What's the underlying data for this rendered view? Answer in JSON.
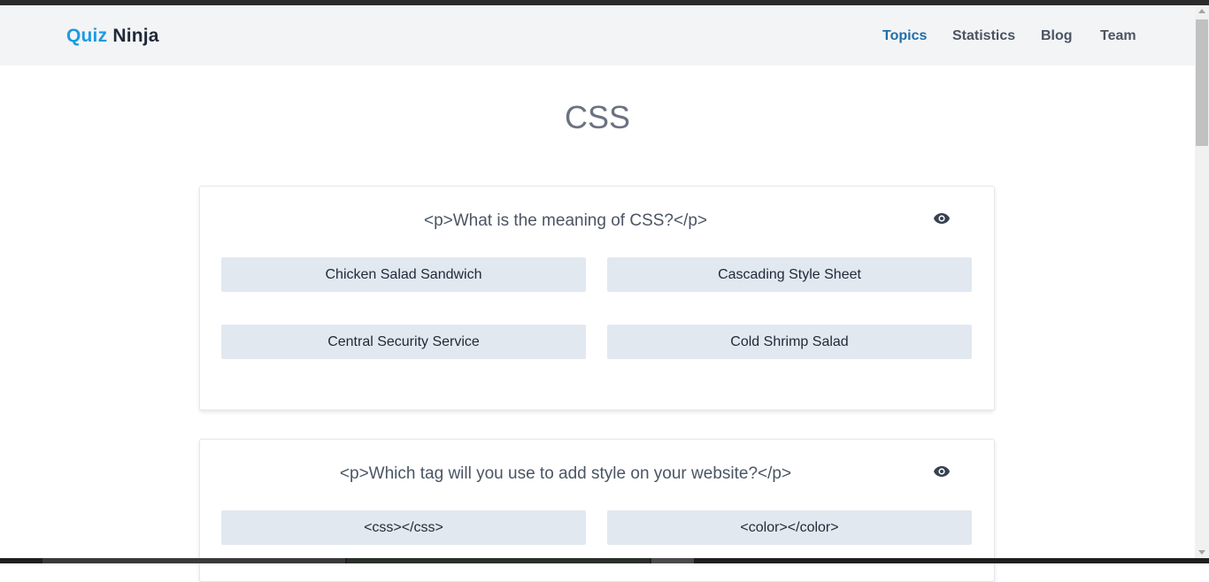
{
  "brand": {
    "part1": "Quiz",
    "part2": "Ninja"
  },
  "nav": {
    "items": [
      {
        "label": "Topics",
        "active": true
      },
      {
        "label": "Statistics",
        "active": false
      },
      {
        "label": "Blog",
        "active": false
      },
      {
        "label": "Team",
        "active": false
      }
    ]
  },
  "page": {
    "title": "CSS"
  },
  "questions": [
    {
      "text": "<p>What is the meaning of CSS?</p>",
      "options": [
        "Chicken Salad Sandwich",
        "Cascading Style Sheet",
        "Central Security Service",
        "Cold Shrimp Salad"
      ]
    },
    {
      "text": "<p>Which tag will you use to add style on your website?</p>",
      "options": [
        "<css></css>",
        "<color></color>"
      ]
    }
  ],
  "colors": {
    "brand_accent": "#1d9be0",
    "nav_active": "#1e6fa8",
    "option_bg": "#e2e8f0",
    "navbar_bg": "#f3f4f6"
  },
  "icons": {
    "reveal": "eye-icon"
  }
}
